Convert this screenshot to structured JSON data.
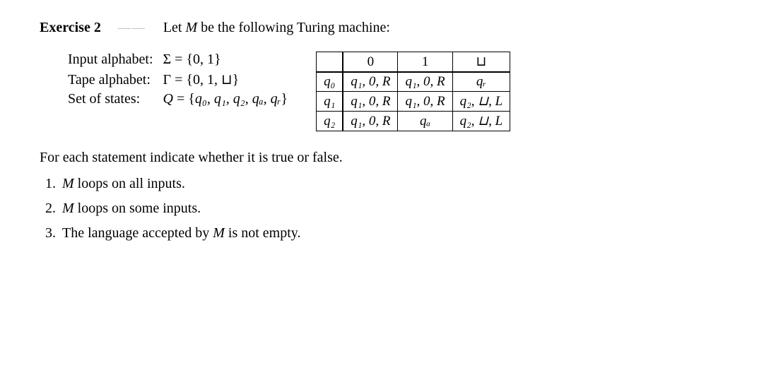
{
  "heading": {
    "label": "Exercise 2",
    "gap": "——",
    "intro_pre": "Let ",
    "machine_sym": "M",
    "intro_post": " be the following Turing machine:"
  },
  "defs": {
    "input_label": "Input alphabet:",
    "input_rhs": "Σ = {0, 1}",
    "tape_label": "Tape alphabet:",
    "tape_rhs": "Γ = {0, 1, ⊔}",
    "states_label": "Set of states:",
    "states_rhs_Q": "Q",
    "states_rhs_eq": " = {",
    "states_list": "q₀, q₁, q₂, qₐ, qᵣ",
    "states_rhs_close": "}"
  },
  "table": {
    "col_headers": [
      "",
      "0",
      "1",
      "⊔"
    ],
    "rows": [
      {
        "state": "q₀",
        "cells": [
          "q₁, 0, R",
          "q₁, 0, R",
          "qᵣ"
        ]
      },
      {
        "state": "q₁",
        "cells": [
          "q₁, 0, R",
          "q₁, 0, R",
          "q₂, ⊔, L"
        ]
      },
      {
        "state": "q₂",
        "cells": [
          "q₁, 0, R",
          "qₐ",
          "q₂, ⊔, L"
        ]
      }
    ]
  },
  "instruction": "For each statement indicate whether it is true or false.",
  "statements": [
    {
      "pre": "",
      "sym": "M",
      "post": " loops on all inputs."
    },
    {
      "pre": "",
      "sym": "M",
      "post": " loops on some inputs."
    },
    {
      "pre": "The language accepted by ",
      "sym": "M",
      "post": " is not empty."
    }
  ]
}
